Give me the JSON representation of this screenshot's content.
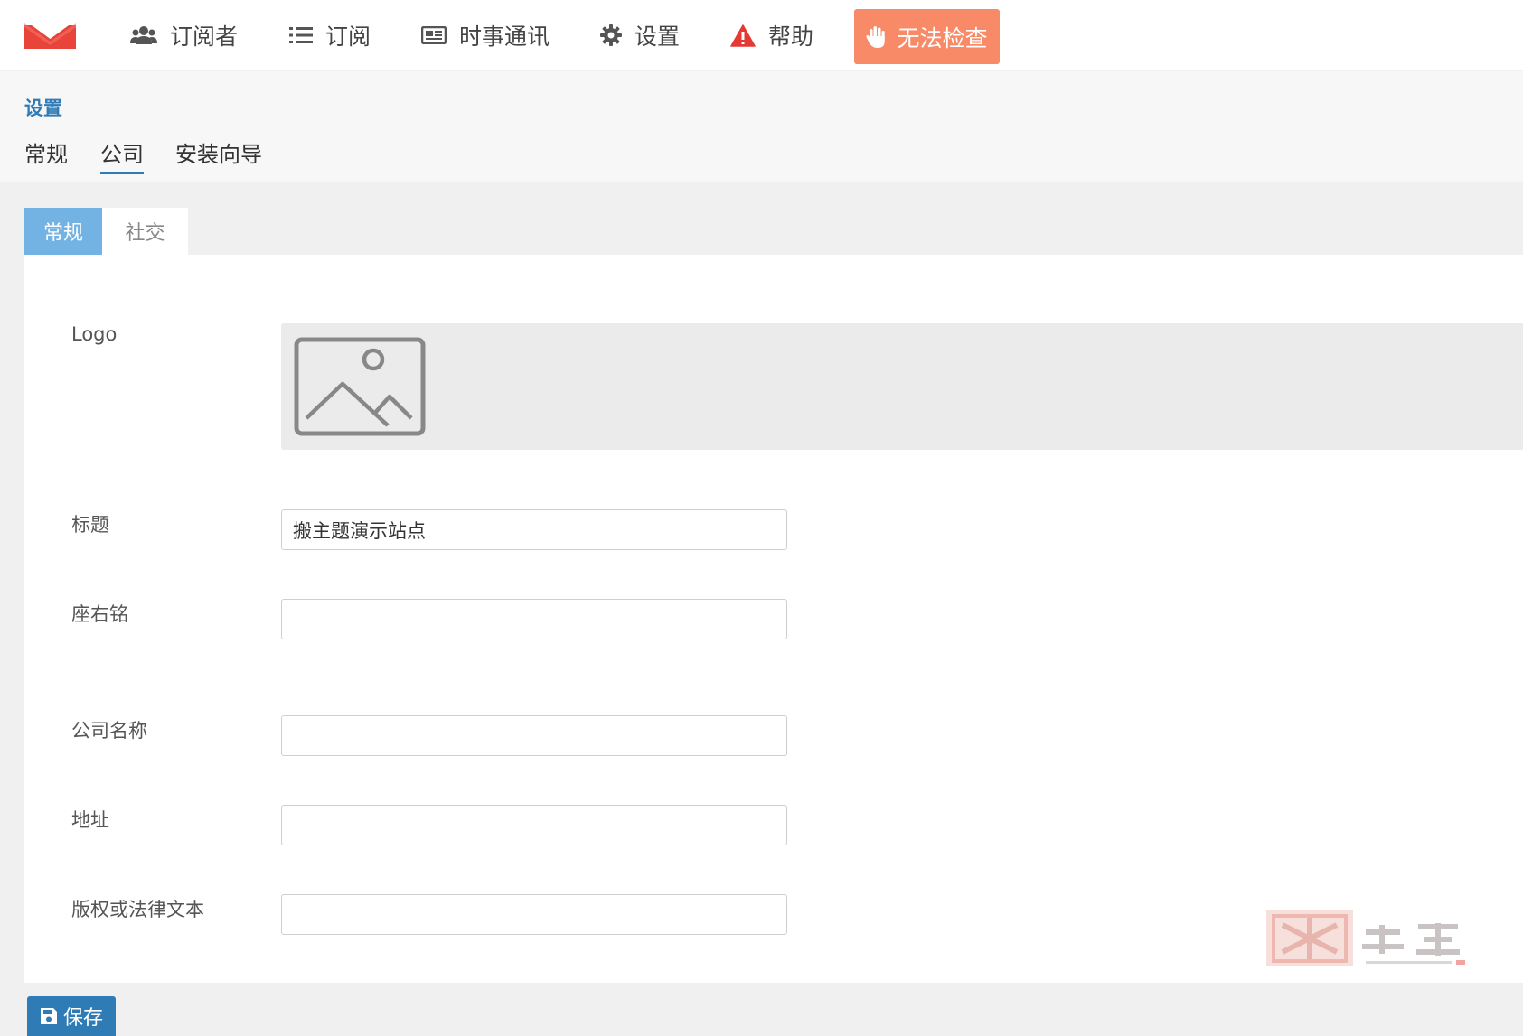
{
  "nav": {
    "items": [
      {
        "label": "订阅者",
        "icon": "users-icon"
      },
      {
        "label": "订阅",
        "icon": "list-icon"
      },
      {
        "label": "时事通讯",
        "icon": "newspaper-icon"
      },
      {
        "label": "设置",
        "icon": "gear-icon"
      },
      {
        "label": "帮助",
        "icon": "warning-icon"
      }
    ],
    "alert_button": {
      "label": "无法检查",
      "icon": "hand-icon"
    }
  },
  "header": {
    "title": "设置",
    "tabs": [
      {
        "label": "常规",
        "active": false
      },
      {
        "label": "公司",
        "active": true
      },
      {
        "label": "安装向导",
        "active": false
      }
    ]
  },
  "inner_tabs": [
    {
      "label": "常规",
      "active": true
    },
    {
      "label": "社交",
      "active": false
    }
  ],
  "form": {
    "logo_label": "Logo",
    "fields": [
      {
        "label": "标题",
        "value": "搬主题演示站点"
      },
      {
        "label": "座右铭",
        "value": ""
      },
      {
        "label": "公司名称",
        "value": ""
      },
      {
        "label": "地址",
        "value": ""
      },
      {
        "label": "版权或法律文本",
        "value": ""
      }
    ]
  },
  "save_button": {
    "label": "保存",
    "icon": "save-icon"
  },
  "colors": {
    "accent": "#2f7bb5",
    "tab_active": "#73b3e3",
    "alert": "#f88a68",
    "brand": "#e8443a",
    "warning": "#e53935"
  }
}
